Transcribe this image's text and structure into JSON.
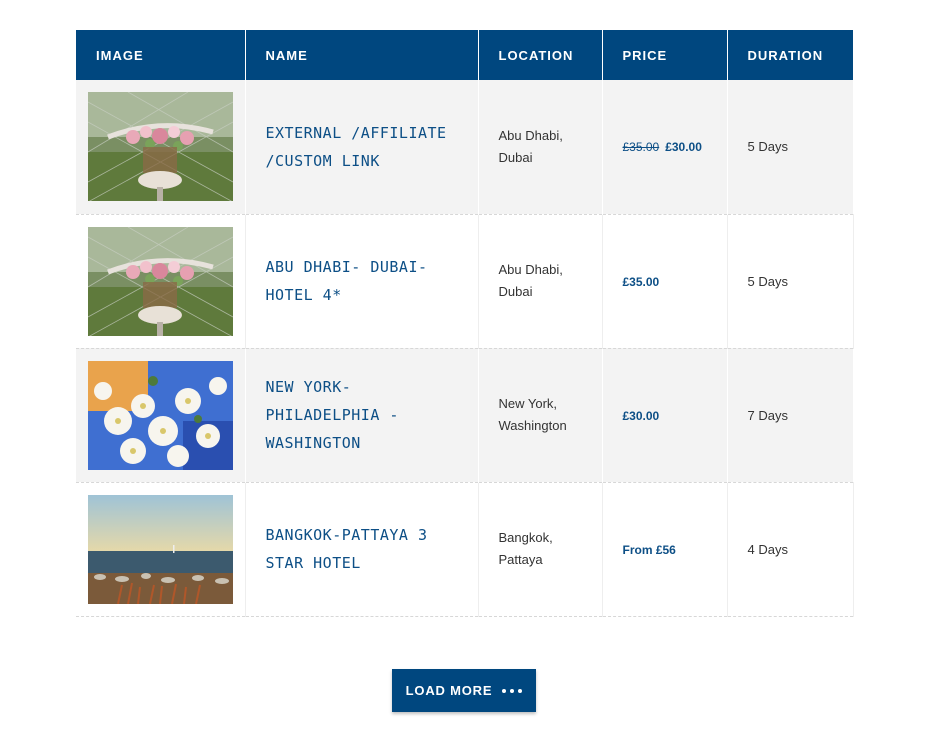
{
  "table": {
    "headers": {
      "image": "Image",
      "name": "Name",
      "location": "Location",
      "price": "Price",
      "duration": "Duration"
    },
    "rows": [
      {
        "image_icon": "bicycle-flowers-photo",
        "name": "External /Affiliate /Custom Link",
        "location_line1": "Abu Dhabi,",
        "location_line2": "Dubai",
        "price_old": "£35.00",
        "price": "£30.00",
        "duration": "5 Days"
      },
      {
        "image_icon": "bicycle-flowers-photo",
        "name": "Abu Dhabi- Dubai- Hotel 4*",
        "location_line1": "Abu Dhabi,",
        "location_line2": "Dubai",
        "price_old": "",
        "price": "£35.00",
        "duration": "5 Days"
      },
      {
        "image_icon": "white-blossoms-photo",
        "name": "New York- Philadelphia - Washington",
        "location_line1": "New York,",
        "location_line2": "Washington",
        "price_old": "",
        "price": "£30.00",
        "duration": "7 Days"
      },
      {
        "image_icon": "seaside-photo",
        "name": "Bangkok-Pattaya 3 Star Hotel",
        "location_line1": "Bangkok,",
        "location_line2": "Pattaya",
        "price_old": "",
        "price": "From £56",
        "duration": "4 Days"
      }
    ]
  },
  "load_more": {
    "label": "Load More",
    "icon": "ellipsis-icon"
  },
  "colors": {
    "header_bg": "#00477f",
    "link": "#0d4f86",
    "row_alt": "#f3f3f3"
  }
}
